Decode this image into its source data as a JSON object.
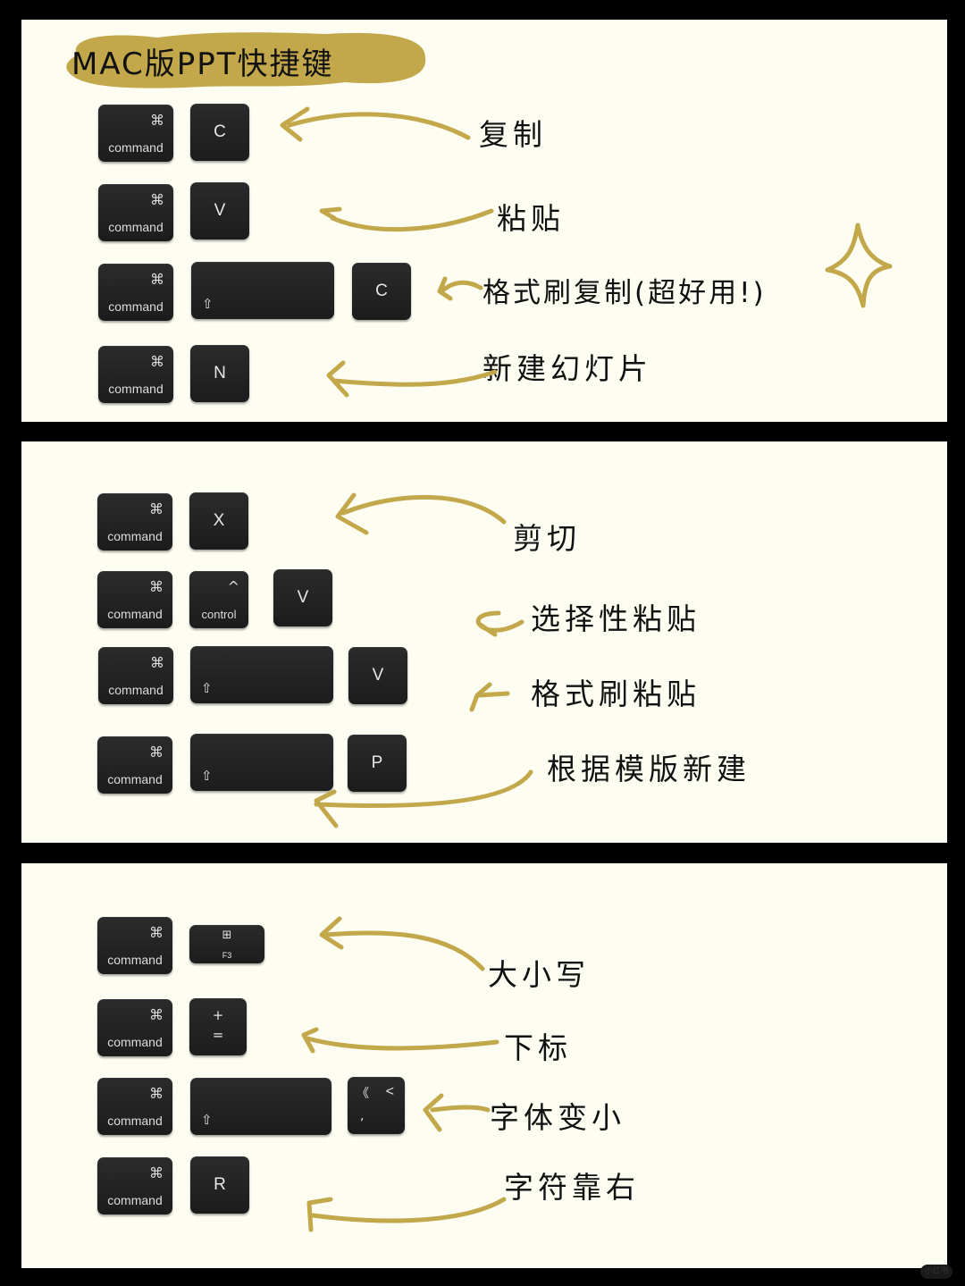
{
  "title": "MAC版PPT快捷键",
  "accent_color": "#c2a84a",
  "panels": [
    {
      "rows": [
        {
          "keys": [
            "command",
            "C"
          ],
          "action": "复制"
        },
        {
          "keys": [
            "command",
            "V"
          ],
          "action": "粘贴"
        },
        {
          "keys": [
            "command",
            "shift",
            "C"
          ],
          "action": "格式刷复制(超好用!)"
        },
        {
          "keys": [
            "command",
            "N"
          ],
          "action": "新建幻灯片"
        }
      ]
    },
    {
      "rows": [
        {
          "keys": [
            "command",
            "X"
          ],
          "action": "剪切"
        },
        {
          "keys": [
            "command",
            "control",
            "V"
          ],
          "action": "选择性粘贴"
        },
        {
          "keys": [
            "command",
            "shift",
            "V"
          ],
          "action": "格式刷粘贴"
        },
        {
          "keys": [
            "command",
            "shift",
            "P"
          ],
          "action": "根据模版新建"
        }
      ]
    },
    {
      "rows": [
        {
          "keys": [
            "command",
            "F3"
          ],
          "action": "大小写"
        },
        {
          "keys": [
            "command",
            "+ ="
          ],
          "action": "下标"
        },
        {
          "keys": [
            "command",
            "shift",
            "< ,"
          ],
          "action": "字体变小"
        },
        {
          "keys": [
            "command",
            "R"
          ],
          "action": "字符靠右"
        }
      ]
    }
  ],
  "key_glyphs": {
    "command_symbol": "⌘",
    "command_word": "command",
    "control_symbol": "^",
    "control_word": "control",
    "shift_symbol": "⇧",
    "f3_symbol": "⊞",
    "f3_word": "F3",
    "plus": "+",
    "equals": "=",
    "lt_top_left": "《",
    "lt_top_right": "<",
    "comma": ","
  },
  "decorations": {
    "sparkle": "sparkle-icon"
  },
  "watermark": "小红书"
}
